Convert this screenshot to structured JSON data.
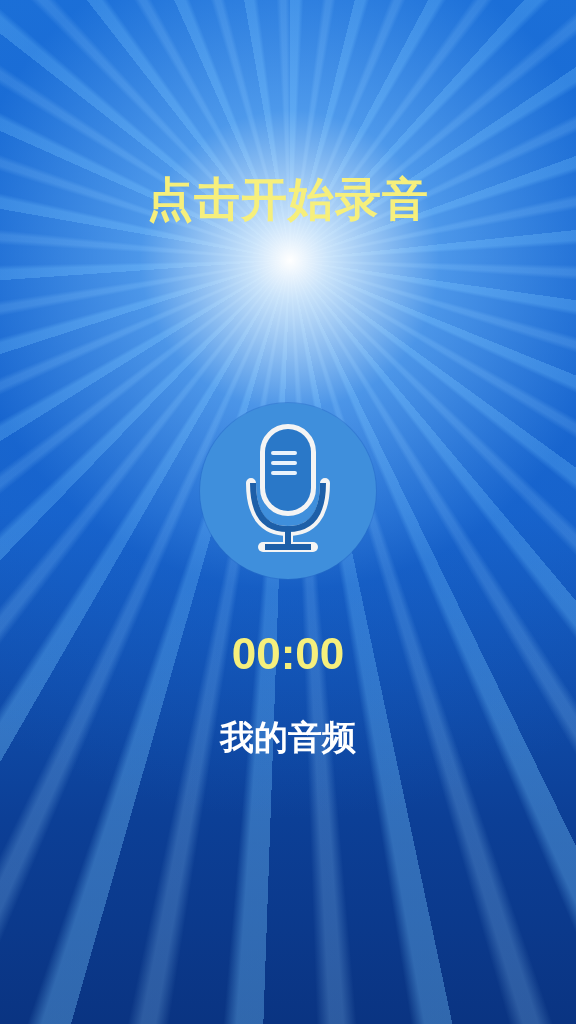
{
  "title": "点击开始录音",
  "timer": "00:00",
  "my_audio": "我的音频"
}
